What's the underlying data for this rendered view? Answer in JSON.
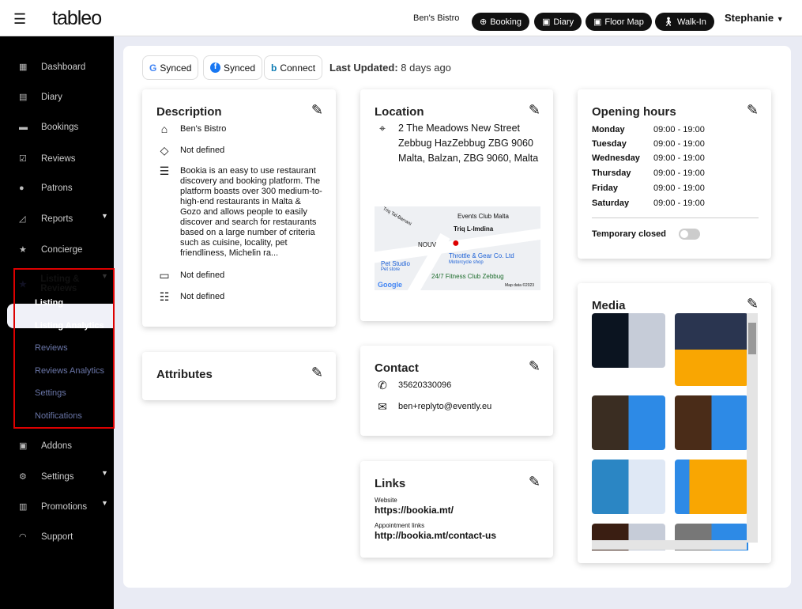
{
  "header": {
    "logo": "tableo",
    "restaurant": "Ben's Bistro",
    "buttons": [
      {
        "label": "Booking",
        "icon": "plus-circle-icon"
      },
      {
        "label": "Diary",
        "icon": "calendar-icon"
      },
      {
        "label": "Floor Map",
        "icon": "calendar-icon"
      },
      {
        "label": "Walk-In",
        "icon": "walking-icon"
      }
    ],
    "user": "Stephanie"
  },
  "sidebar": {
    "items": [
      {
        "label": "Dashboard"
      },
      {
        "label": "Diary"
      },
      {
        "label": "Bookings"
      },
      {
        "label": "Reviews"
      },
      {
        "label": "Patrons"
      },
      {
        "label": "Reports"
      },
      {
        "label": "Concierge"
      },
      {
        "label": "Listing & Reviews"
      },
      {
        "label": "Addons"
      },
      {
        "label": "Settings"
      },
      {
        "label": "Promotions"
      },
      {
        "label": "Support"
      }
    ],
    "sub": [
      {
        "label": "Listing"
      },
      {
        "label": "Listing Analytics"
      },
      {
        "label": "Reviews"
      },
      {
        "label": "Reviews Analytics"
      },
      {
        "label": "Settings"
      },
      {
        "label": "Notifications"
      }
    ]
  },
  "sync": {
    "google": "Synced",
    "facebook": "Synced",
    "bing": "Connect",
    "last_label": "Last Updated:",
    "last_value": "8 days ago"
  },
  "description": {
    "title": "Description",
    "name": "Ben's Bistro",
    "tags": "Not defined",
    "text": "Bookia is an easy to use restaurant discovery and booking platform. The platform boasts over 300 medium-to-high-end restaurants in Malta & Gozo and allows people to easily discover and search for restaurants based on a large number of criteria such as cuisine, locality, pet friendliness, Michelin ra...",
    "field4": "Not defined",
    "field5": "Not defined"
  },
  "attributes": {
    "title": "Attributes"
  },
  "location": {
    "title": "Location",
    "address": "2 The Meadows New Street Zebbug HazZebbug ZBG 9060 Malta, Balzan, ZBG 9060, Malta",
    "map": {
      "street1": "Triq L-Imdina",
      "street2": "Triq Tal-Barrani",
      "poi1": "Events Club Malta",
      "poi2": "NOUV",
      "poi3": "Throttle & Gear Co. Ltd",
      "poi3sub": "Motorcycle shop",
      "poi4": "Pet Studio",
      "poi4sub": "Pet store",
      "poi5": "24/7 Fitness Club Zebbug",
      "brand": "Google",
      "credit": "Map data ©2023"
    }
  },
  "contact": {
    "title": "Contact",
    "phone": "35620330096",
    "email": "ben+replyto@evently.eu"
  },
  "links": {
    "title": "Links",
    "website_label": "Website",
    "website": "https://bookia.mt/",
    "appt_label": "Appointment links",
    "appt": "http://bookia.mt/contact-us"
  },
  "hours": {
    "title": "Opening hours",
    "days": [
      {
        "day": "Monday",
        "time": "09:00 - 19:00"
      },
      {
        "day": "Tuesday",
        "time": "09:00 - 19:00"
      },
      {
        "day": "Wednesday",
        "time": "09:00 - 19:00"
      },
      {
        "day": "Thursday",
        "time": "09:00 - 19:00"
      },
      {
        "day": "Friday",
        "time": "09:00 - 19:00"
      },
      {
        "day": "Saturday",
        "time": "09:00 - 19:00"
      }
    ],
    "temp_closed": "Temporary closed",
    "temp_closed_on": false
  },
  "media": {
    "title": "Media"
  }
}
